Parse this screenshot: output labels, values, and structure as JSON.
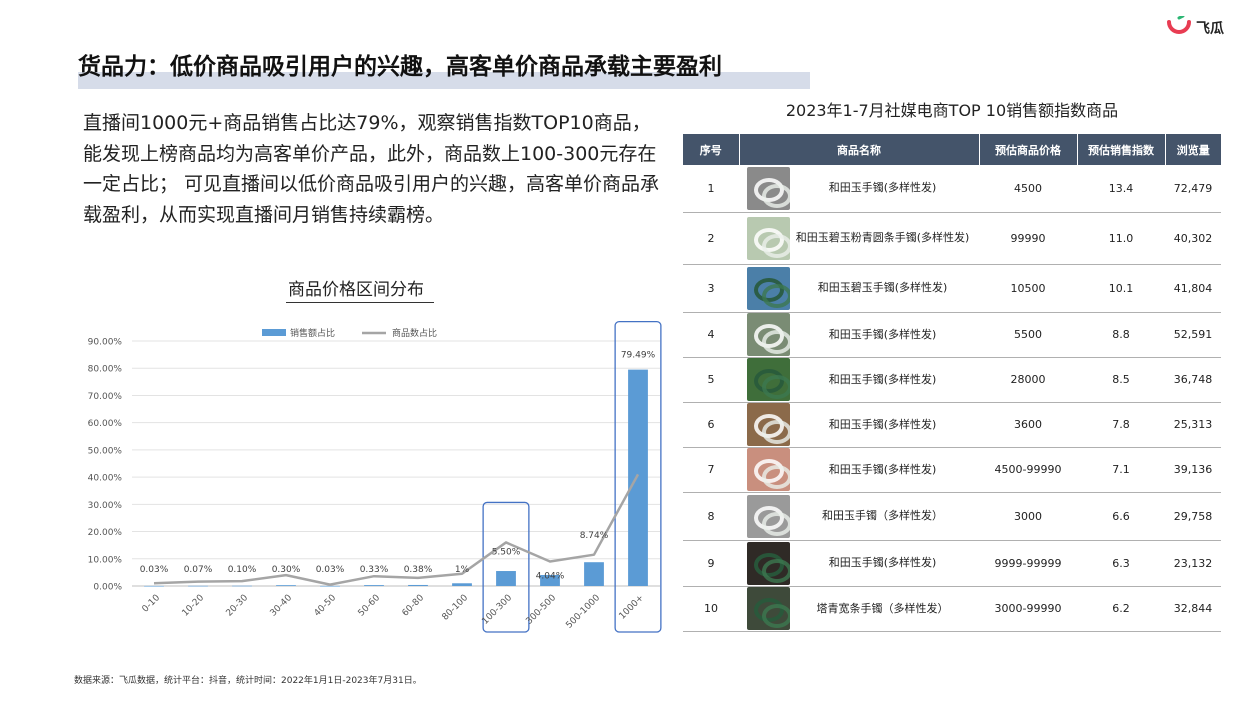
{
  "brand": {
    "name": "飞瓜",
    "accent": "#e83c52",
    "accent2": "#2bb673"
  },
  "page": {
    "title": "货品力：低价商品吸引用户的兴趣，高客单价商品承载主要盈利",
    "intro": "直播间1000元+商品销售占比达79%，观察销售指数TOP10商品，能发现上榜商品均为高客单价产品，此外，商品数上100-300元存在一定占比； 可见直播间以低价商品吸引用户的兴趣，高客单价商品承载盈利，从而实现直播间月销售持续霸榜。",
    "footnote": "数据来源：飞瓜数据，统计平台：抖音，统计时间：2022年1月1日-2023年7月31日。"
  },
  "chart_data": {
    "type": "bar",
    "title": "商品价格区间分布",
    "categories": [
      "0-10",
      "10-20",
      "20-30",
      "30-40",
      "40-50",
      "50-60",
      "60-80",
      "80-100",
      "100-300",
      "300-500",
      "500-1000",
      "1000+"
    ],
    "series": [
      {
        "name": "销售额占比",
        "type": "bar",
        "color": "#5b9bd5",
        "values": [
          0.03,
          0.07,
          0.1,
          0.3,
          0.03,
          0.33,
          0.38,
          1.0,
          5.5,
          4.04,
          8.74,
          79.49
        ],
        "labels": [
          "0.03%",
          "0.07%",
          "0.10%",
          "0.30%",
          "0.03%",
          "0.33%",
          "0.38%",
          "1%",
          "5.50%",
          "4.04%",
          "8.74%",
          "79.49%"
        ]
      },
      {
        "name": "商品数占比",
        "type": "line",
        "color": "#a5a5a5",
        "values": [
          1.0,
          1.6,
          1.8,
          4.0,
          0.5,
          3.6,
          3.0,
          4.5,
          16.0,
          9.0,
          11.5,
          41.0
        ]
      }
    ],
    "yticks": [
      "0.00%",
      "10.00%",
      "20.00%",
      "30.00%",
      "40.00%",
      "50.00%",
      "60.00%",
      "70.00%",
      "80.00%",
      "90.00%"
    ],
    "ylim": [
      0,
      90
    ],
    "highlight_categories": [
      "100-300",
      "1000+"
    ],
    "highlight_color": "#4472c4",
    "grid": true,
    "legend": "top"
  },
  "table": {
    "title": "2023年1-7月社媒电商TOP 10销售额指数商品",
    "headers": [
      "序号",
      "商品名称",
      "预估商品价格",
      "预估销售指数",
      "浏览量"
    ],
    "rows": [
      {
        "rank": "1",
        "name": "和田玉手镯(多样性发)",
        "price": "4500",
        "index": "13.4",
        "views": "72,479",
        "thumb": "#8a8a8a"
      },
      {
        "rank": "2",
        "name": "和田玉碧玉粉青圆条手镯(多样性发)",
        "price": "99990",
        "index": "11.0",
        "views": "40,302",
        "thumb": "#b8c9b0"
      },
      {
        "rank": "3",
        "name": "和田玉碧玉手镯(多样性发)",
        "price": "10500",
        "index": "10.1",
        "views": "41,804",
        "thumb": "#4b7fa8"
      },
      {
        "rank": "4",
        "name": "和田玉手镯(多样性发)",
        "price": "5500",
        "index": "8.8",
        "views": "52,591",
        "thumb": "#7a8c74"
      },
      {
        "rank": "5",
        "name": "和田玉手镯(多样性发)",
        "price": "28000",
        "index": "8.5",
        "views": "36,748",
        "thumb": "#3f6e3a"
      },
      {
        "rank": "6",
        "name": "和田玉手镯(多样性发)",
        "price": "3600",
        "index": "7.8",
        "views": "25,313",
        "thumb": "#8b6a4a"
      },
      {
        "rank": "7",
        "name": "和田玉手镯(多样性发)",
        "price": "4500-99990",
        "index": "7.1",
        "views": "39,136",
        "thumb": "#c98f7e"
      },
      {
        "rank": "8",
        "name": "和田玉手镯（多样性发）",
        "price": "3000",
        "index": "6.6",
        "views": "29,758",
        "thumb": "#9a9a9a"
      },
      {
        "rank": "9",
        "name": "和田玉手镯(多样性发)",
        "price": "9999-99999",
        "index": "6.3",
        "views": "23,132",
        "thumb": "#2f2a26"
      },
      {
        "rank": "10",
        "name": "塔青宽条手镯（多样性发）",
        "price": "3000-99990",
        "index": "6.2",
        "views": "32,844",
        "thumb": "#3e4a3a"
      }
    ]
  }
}
